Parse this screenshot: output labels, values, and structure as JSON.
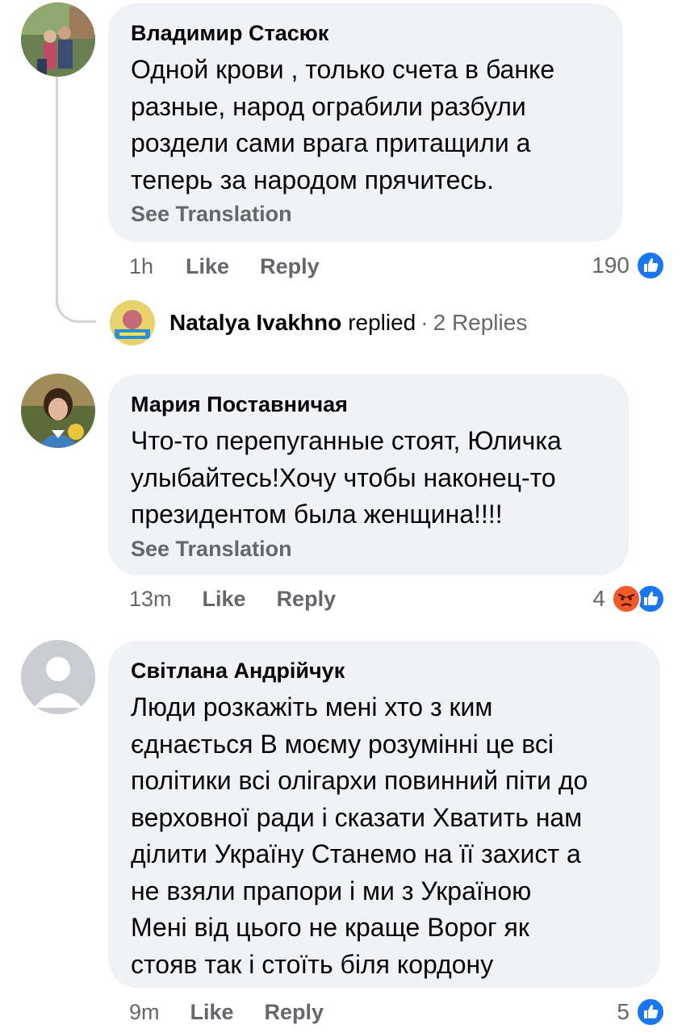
{
  "comments": [
    {
      "author": "Владимир Стасюк",
      "lines": [
        "Одной крови  , только счета в банке",
        "разные, народ ограбили разбули",
        "роздели сами врага притащили а",
        "теперь за народом прячитесь."
      ],
      "see_translation": "See Translation",
      "time": "1h",
      "like_label": "Like",
      "reply_label": "Reply",
      "reaction_count": "190",
      "reactions": [
        "like-icon"
      ],
      "replies": {
        "name": "Natalya Ivakhno",
        "verb": "replied",
        "separator": "·",
        "count_label": "2 Replies"
      }
    },
    {
      "author": "Мария Поставничая",
      "lines": [
        "Что-то перепуганные стоят, Юличка",
        "улыбайтесь!Хочу чтобы наконец-то",
        "президентом была женщина!!!!"
      ],
      "see_translation": "See Translation",
      "time": "13m",
      "like_label": "Like",
      "reply_label": "Reply",
      "reaction_count": "4",
      "reactions": [
        "angry-icon",
        "like-icon"
      ]
    },
    {
      "author": "Світлана Андрійчук",
      "lines": [
        "Люди розкажіть мені хто з ким",
        "єднається В моєму розумінні це всі",
        "політики всі олігархи повинний піти до",
        "верховної ради і сказати Хватить  нам",
        "ділити Україну Станемо на її захист а",
        "не взяли прапори і ми з Україною",
        "Мені від цього не краще Ворог як",
        "стояв так і стоїть біля кордону"
      ],
      "time": "9m",
      "like_label": "Like",
      "reply_label": "Reply",
      "reaction_count": "5",
      "reactions": [
        "like-icon"
      ]
    }
  ],
  "colors": {
    "bubble": "#f0f2f5",
    "secondary_text": "#65676b",
    "like_blue": "#1877f2",
    "angry_orange": "#f0592a"
  }
}
